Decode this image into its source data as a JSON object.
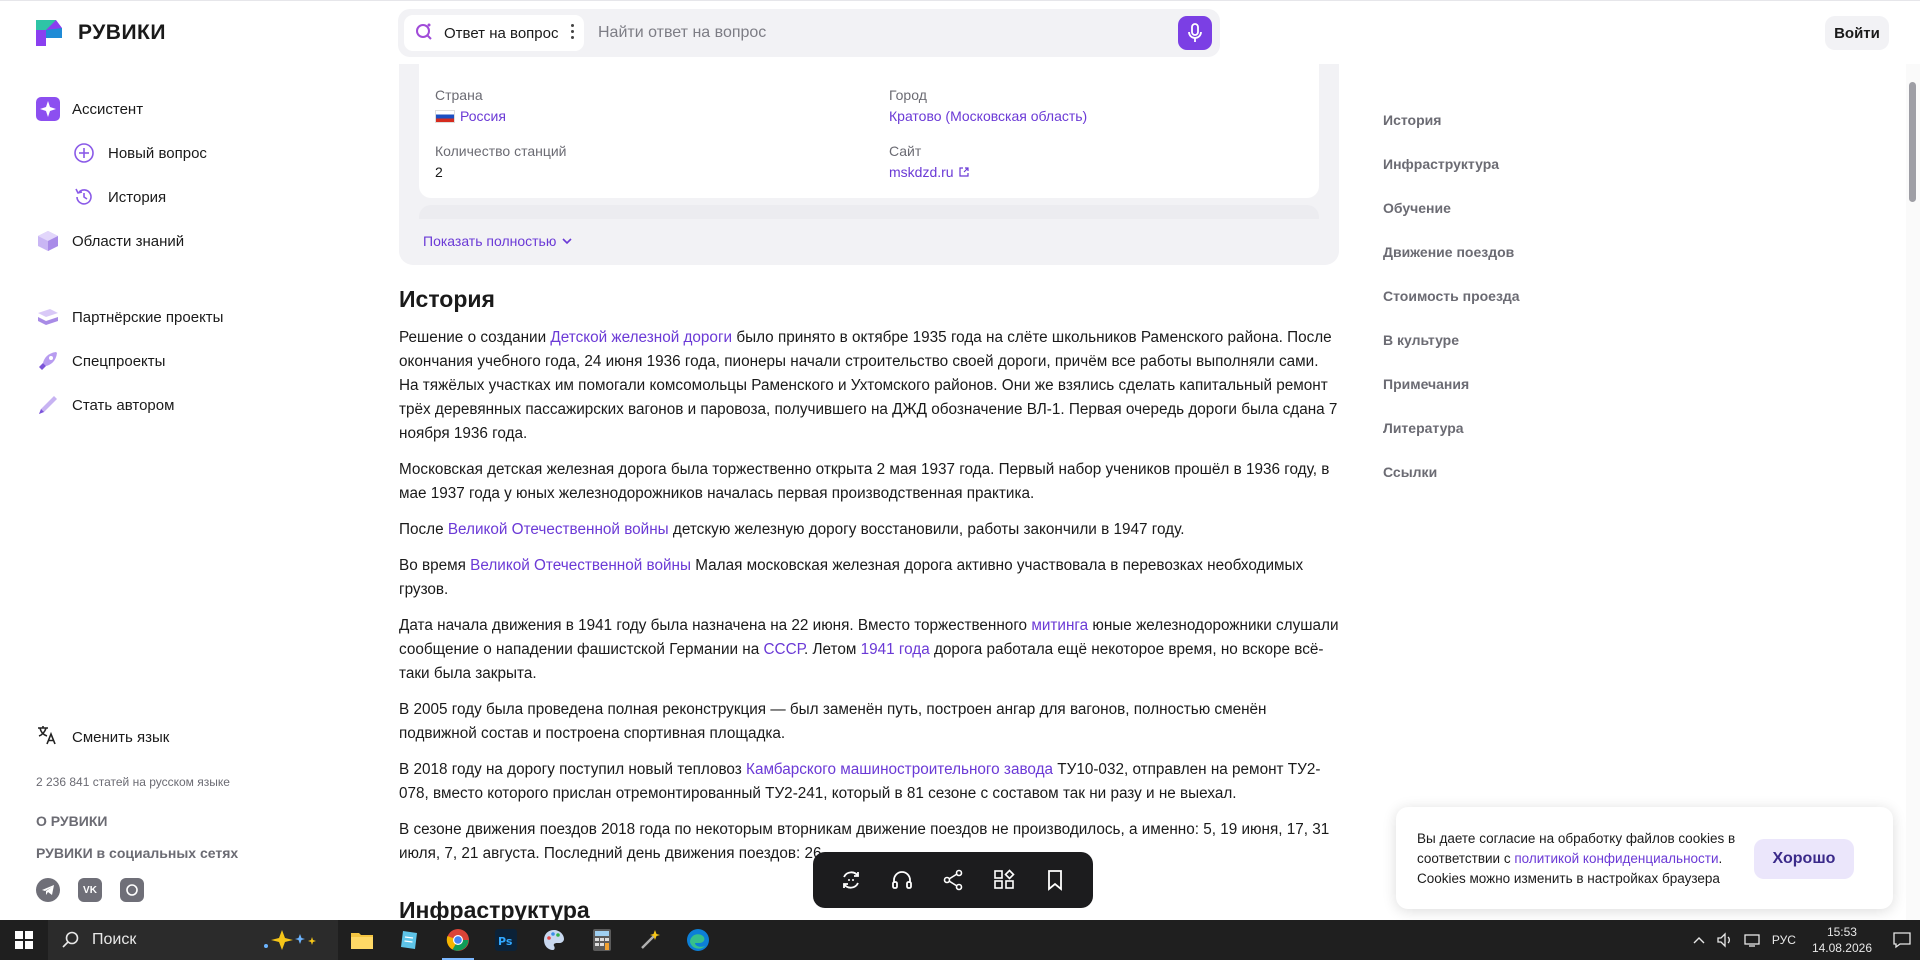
{
  "header": {
    "logo_text": "РУВИКИ",
    "search_mode": "Ответ на вопрос",
    "search_placeholder": "Найти ответ на вопрос",
    "login_label": "Войти"
  },
  "sidebar": {
    "items": [
      {
        "label": "Ассистент"
      },
      {
        "label": "Новый вопрос"
      },
      {
        "label": "История"
      },
      {
        "label": "Области знаний"
      },
      {
        "label": "Партнёрские проекты"
      },
      {
        "label": "Спецпроекты"
      },
      {
        "label": "Стать автором"
      }
    ],
    "lang_switch": "Сменить язык",
    "stats": "2 236 841 статей на русском языке",
    "about": "О РУВИКИ",
    "social_title": "РУВИКИ в социальных сетях",
    "socials": [
      "telegram-icon",
      "vk-icon",
      "dzen-icon"
    ]
  },
  "infobox": {
    "country_label": "Страна",
    "country_value": "Россия",
    "city_label": "Город",
    "city_value": "Кратово (Московская область)",
    "stations_label": "Количество станций",
    "stations_value": "2",
    "site_label": "Сайт",
    "site_value": "mskdzd.ru",
    "show_more": "Показать полностью"
  },
  "article": {
    "heading": "История",
    "p1": {
      "a": "Решение о создании ",
      "link": "Детской железной дороги",
      "b": " было принято в октябре 1935 года на слёте школьников Раменского района. После окончания учебного года, 24 июня 1936 года, пионеры начали строительство своей дороги, причём все работы выполняли сами. На тяжёлых участках им помогали комсомольцы Раменского и Ухтомского районов. Они же взялись сделать капитальный ремонт трёх деревянных пассажирских вагонов и паровоза, получившего на ДЖД обозначение ВЛ-1. Первая очередь дороги была сдана 7 ноября 1936 года."
    },
    "p2": "Московская детская железная дорога была торжественно открыта 2 мая 1937 года. Первый набор учеников прошёл в 1936 году, в мае 1937 года у юных железнодорожников началась первая производственная практика.",
    "p3": {
      "a": "После ",
      "link": "Великой Отечественной войны",
      "b": " детскую железную дорогу восстановили, работы закончили в 1947 году."
    },
    "p4": {
      "a": "Во время ",
      "link": "Великой Отечественной войны",
      "b": " Малая московская железная дорога активно участвовала в перевозках необходимых грузов."
    },
    "p5": {
      "a": "Дата начала движения в 1941 году была назначена на 22 июня. Вместо торжественного ",
      "link1": "митинга",
      "b": " юные железнодорожники слушали сообщение о нападении фашистской Германии на ",
      "link2": "СССР",
      "c": ". Летом ",
      "link3": "1941 года",
      "d": " дорога работала ещё некоторое время, но вскоре всё-таки была закрыта."
    },
    "p6": "В 2005 году была проведена полная реконструкция — был заменён путь, построен ангар для вагонов, полностью сменён подвижной состав и построена спортивная площадка.",
    "p7": {
      "a": "В 2018 году на дорогу поступил новый тепловоз ",
      "link": "Камбарского машиностроительного завода",
      "b": " ТУ10-032, отправлен на ремонт ТУ2-078, вместо которого прислан отремонтированный ТУ2-241, который в 81 сезоне с составом так ни разу и не выехал."
    },
    "p8": "В сезоне движения поездов 2018 года по некоторым вторникам движение поездов не производилось, а именно: 5, 19 июня, 17, 31 июля, 7, 21 августа. Последний день движения поездов: 26",
    "next_heading": "Инфраструктура"
  },
  "toc": [
    "История",
    "Инфраструктура",
    "Обучение",
    "Движение поездов",
    "Стоимость проезда",
    "В культуре",
    "Примечания",
    "Литература",
    "Ссылки"
  ],
  "toolbar": [
    "refresh-icon",
    "headphones-icon",
    "share-icon",
    "widgets-icon",
    "bookmark-icon"
  ],
  "cookie": {
    "text_a": "Вы даете согласие на обработку файлов cookies в соответствии с ",
    "link": "политикой конфиденциальности",
    "text_b": ". Cookies можно изменить в настройках браузера",
    "button": "Хорошо"
  },
  "taskbar": {
    "search_label": "Поиск",
    "lang": "РУС",
    "time": "15:53",
    "date": "14.08.2026"
  },
  "colors": {
    "accent": "#7b3fe4",
    "link": "#6b3ad6",
    "muted": "#6b6b73",
    "panel": "#f2f2f5"
  }
}
